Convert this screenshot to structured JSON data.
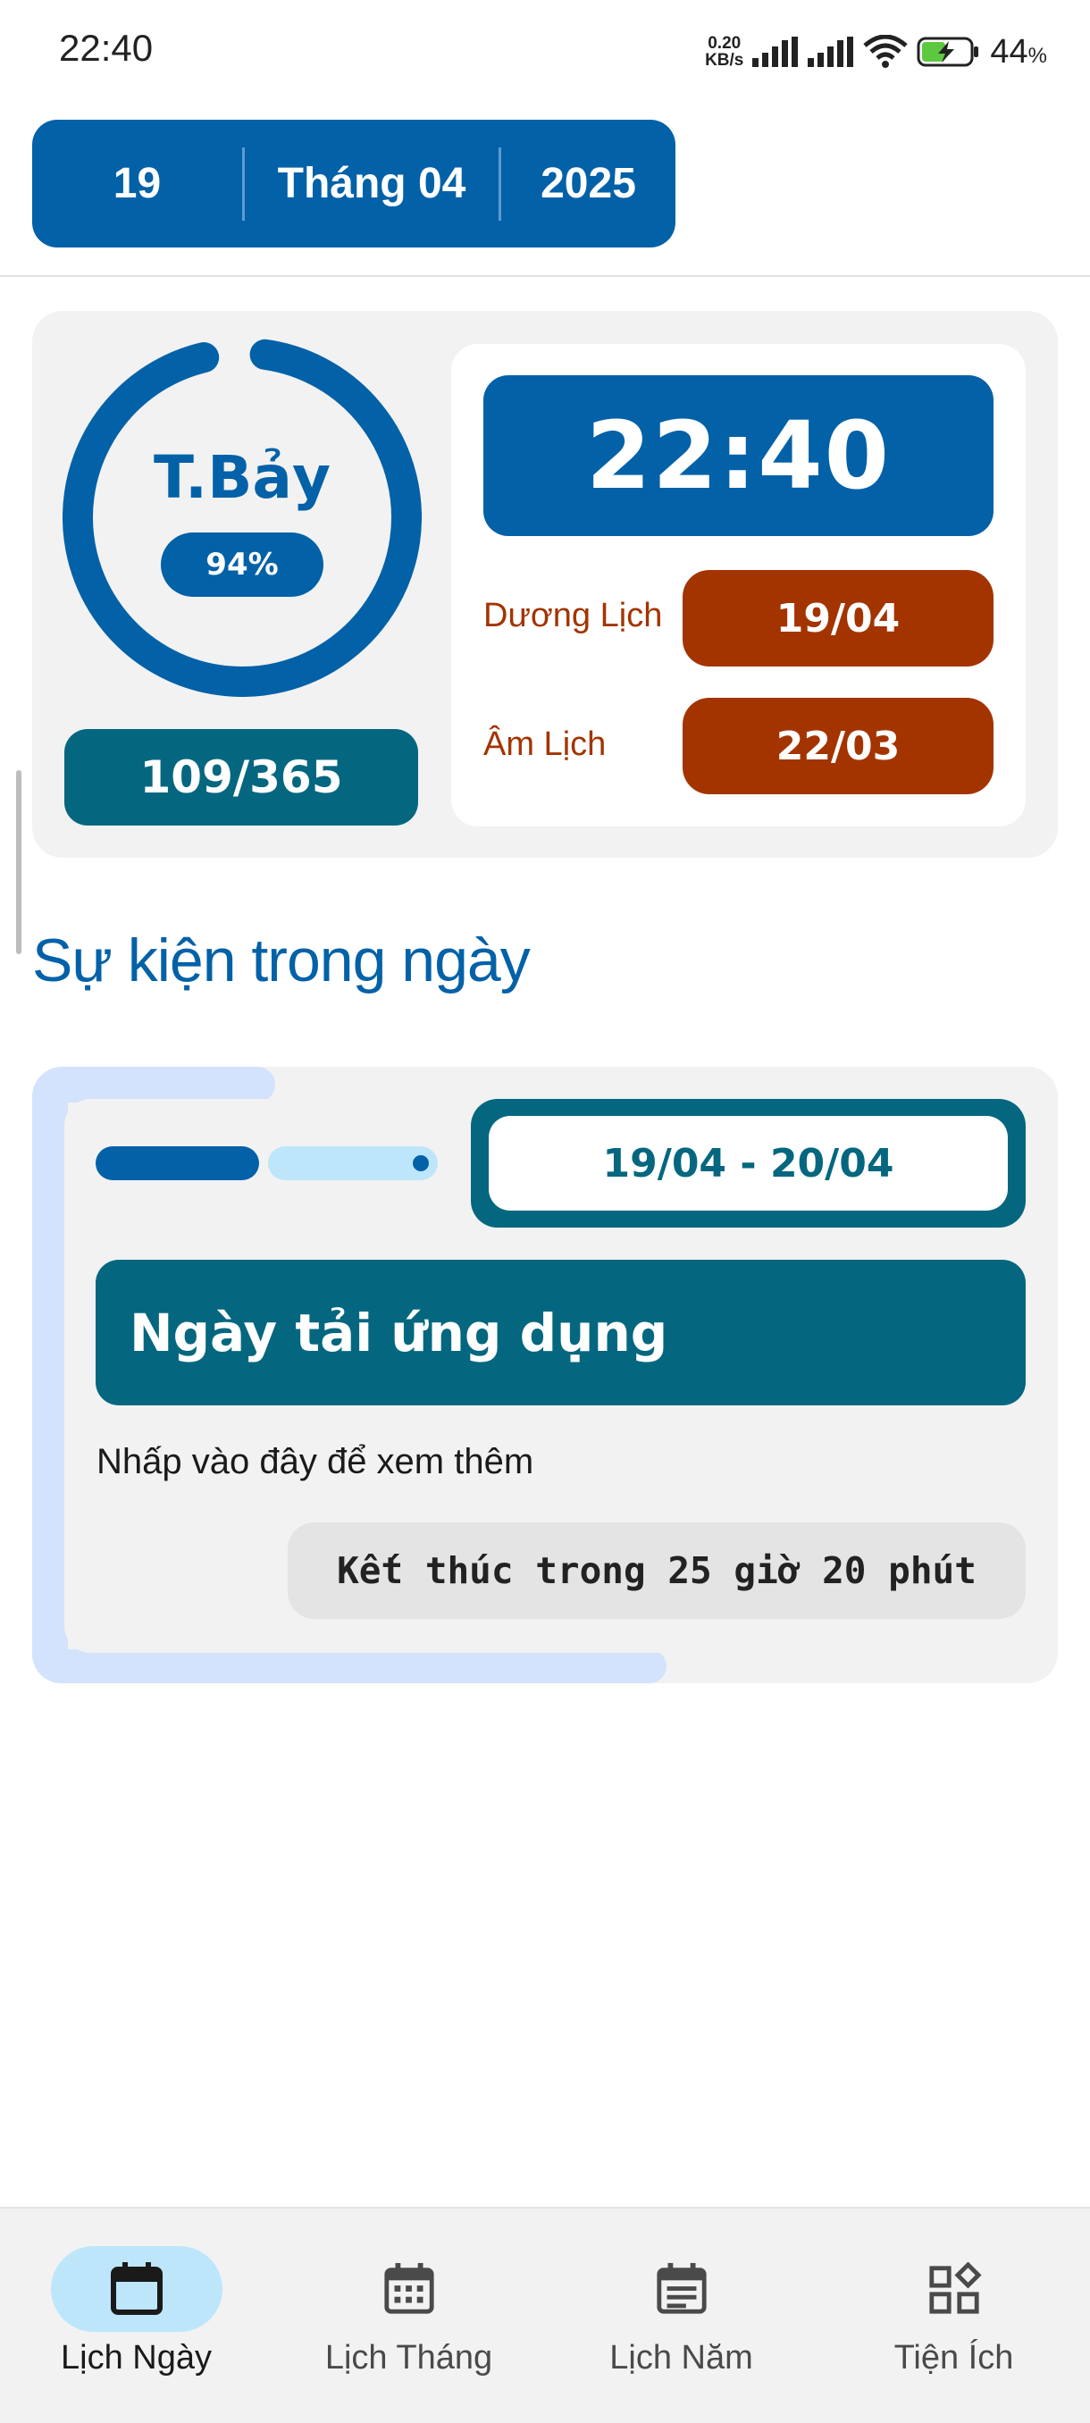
{
  "status_bar": {
    "time": "22:40",
    "net_speed_value": "0.20",
    "net_speed_unit": "KB/s",
    "battery_percent": "44",
    "battery_unit": "%"
  },
  "date_picker": {
    "day": "19",
    "month": "Tháng 04",
    "year": "2025"
  },
  "summary": {
    "weekday": "T.Bảy",
    "progress_label": "94%",
    "progress_fraction": 0.94,
    "day_of_year": "109/365",
    "clock": "22:40",
    "solar_label": "Dương Lịch",
    "solar_date": "19/04",
    "lunar_label": "Âm Lịch",
    "lunar_date": "22/03",
    "accent_color": "#0361a8",
    "lunar_color": "#a33400",
    "teal_color": "#04677f"
  },
  "events_section": {
    "title": "Sự kiện trong ngày",
    "event": {
      "date_range": "19/04 - 20/04",
      "title": "Ngày tải ứng dụng",
      "hint": "Nhấp vào đây để xem thêm",
      "countdown": "Kết thúc trong 25 giờ 20 phút"
    }
  },
  "bottom_nav": {
    "items": [
      {
        "label": "Lịch Ngày",
        "icon": "calendar-day-icon",
        "active": true
      },
      {
        "label": "Lịch Tháng",
        "icon": "calendar-month-icon",
        "active": false
      },
      {
        "label": "Lịch Năm",
        "icon": "calendar-year-icon",
        "active": false
      },
      {
        "label": "Tiện Ích",
        "icon": "widgets-icon",
        "active": false
      }
    ]
  }
}
